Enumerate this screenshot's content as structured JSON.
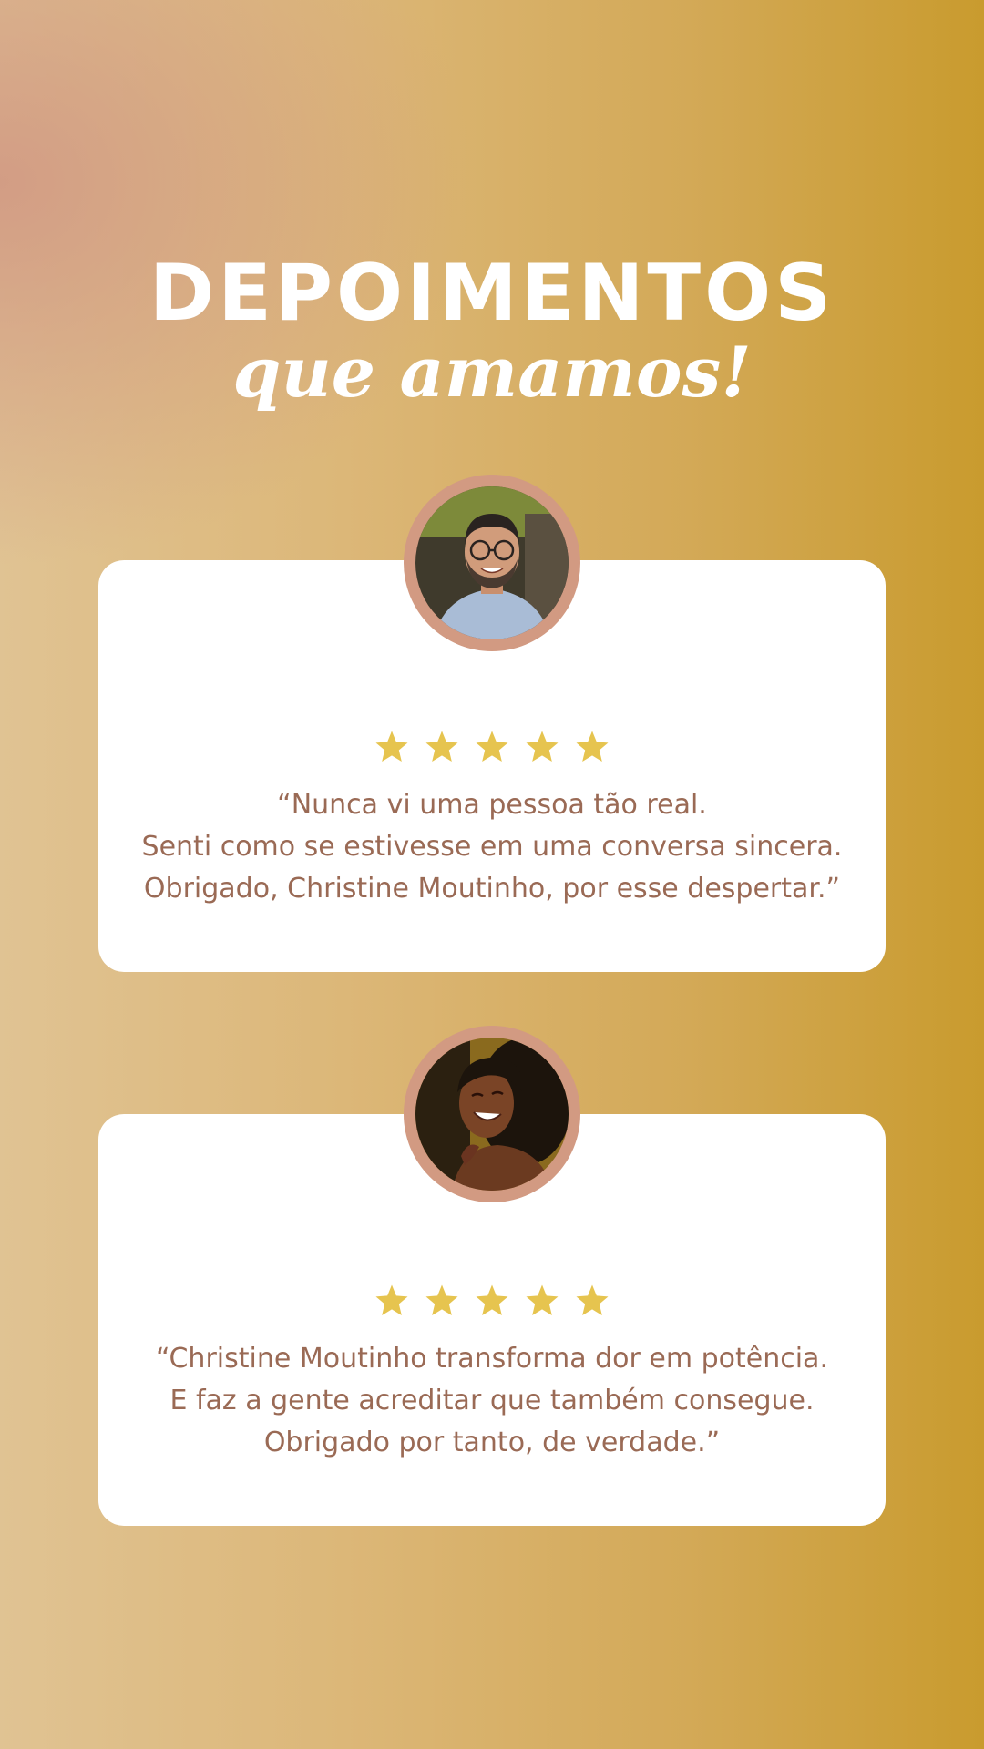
{
  "header": {
    "title": "DEPOIMENTOS",
    "subtitle": "que amamos!"
  },
  "theme": {
    "star_color": "#e6c44f",
    "quote_color": "#9a6a55",
    "avatar_ring_color": "#d29a82"
  },
  "testimonials": [
    {
      "rating": 5,
      "avatar": "man-with-glasses-photo",
      "lines": [
        "“Nunca vi uma pessoa tão real.",
        "Senti como se estivesse em uma conversa sincera.",
        "Obrigado, Christine Moutinho, por esse despertar.”"
      ]
    },
    {
      "rating": 5,
      "avatar": "smiling-woman-photo",
      "lines": [
        "“Christine Moutinho transforma dor em potência.",
        "E faz a gente acreditar que também consegue.",
        "Obrigado por tanto, de verdade.”"
      ]
    }
  ]
}
